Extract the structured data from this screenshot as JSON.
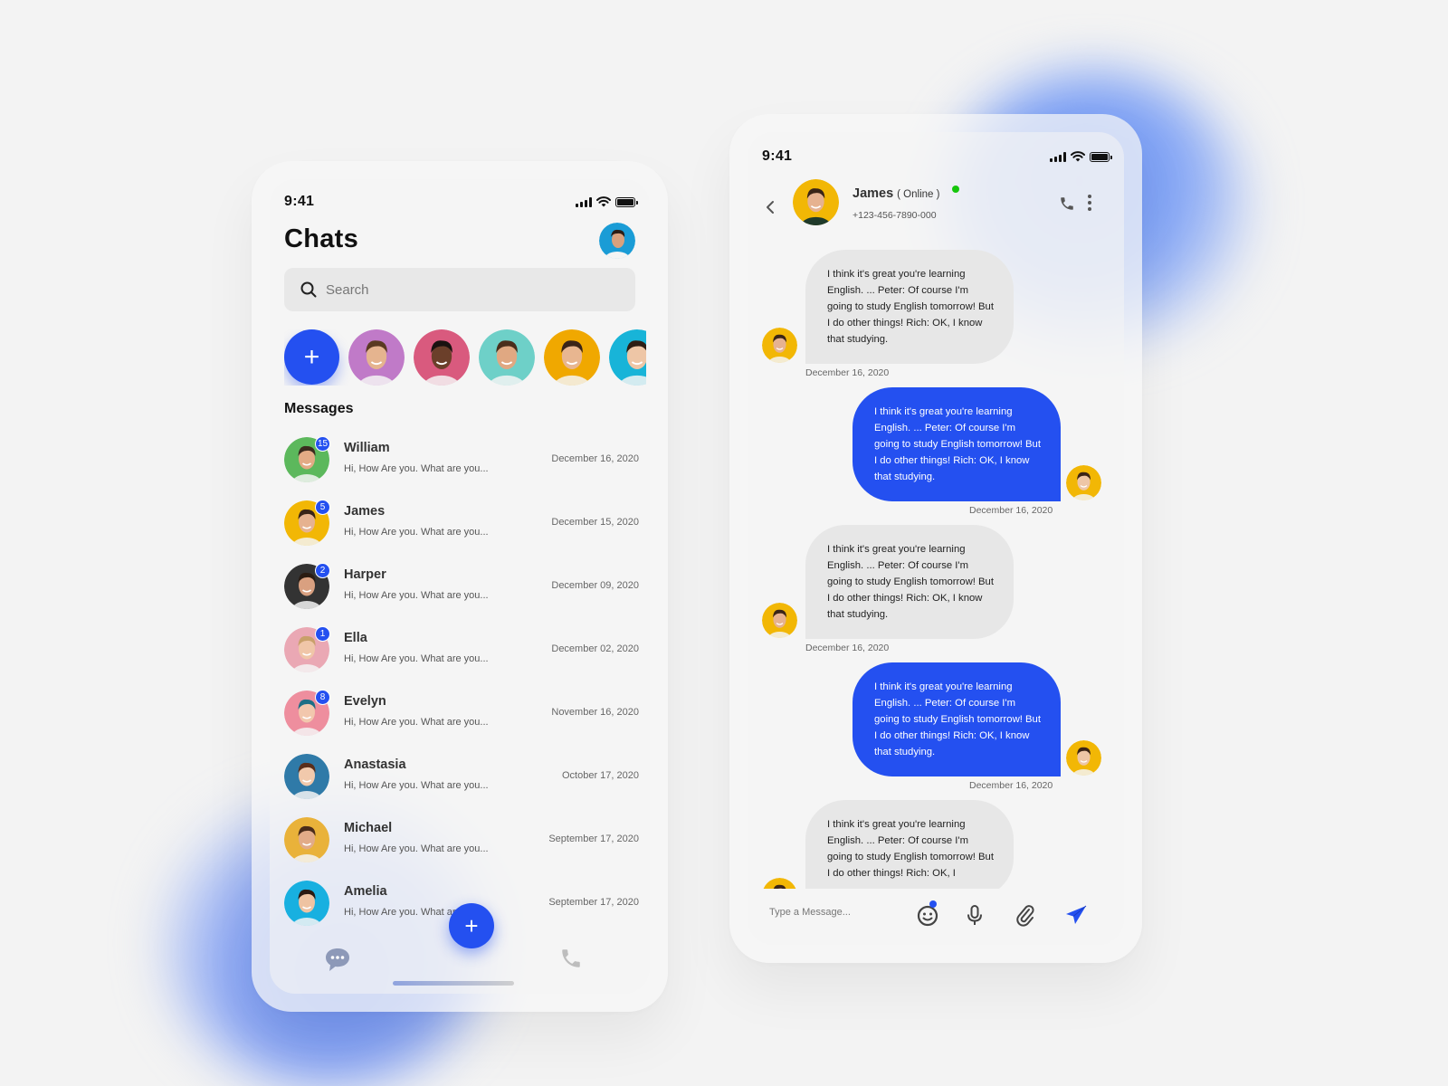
{
  "colors": {
    "accent": "#2450f0",
    "online": "#16c60c",
    "bubble_in": "#e7e7e7",
    "background": "#f3f3f3"
  },
  "chats_screen": {
    "status_time": "9:41",
    "title": "Chats",
    "search": {
      "placeholder": "Search",
      "value": ""
    },
    "add_story_label": "+",
    "stories": [
      {
        "name": "story-1",
        "bg": "#c07ac8",
        "skin": "#e5b48f",
        "hair": "#5a3a22"
      },
      {
        "name": "story-2",
        "bg": "#d95a7e",
        "skin": "#6b3f2a",
        "hair": "#1a1210"
      },
      {
        "name": "story-3",
        "bg": "#6ed0c8",
        "skin": "#e0a882",
        "hair": "#4a2e1c"
      },
      {
        "name": "story-4",
        "bg": "#f0a800",
        "skin": "#e8b690",
        "hair": "#3a2418"
      },
      {
        "name": "story-5",
        "bg": "#18b4d8",
        "skin": "#eec6a6",
        "hair": "#2e1e14"
      }
    ],
    "messages_heading": "Messages",
    "chats": [
      {
        "name": "William",
        "preview": "Hi, How Are you. What are you...",
        "date": "December 16, 2020",
        "unread": "15",
        "bg": "#5cb85c",
        "skin": "#e3ab85",
        "hair": "#3b2a1e"
      },
      {
        "name": "James",
        "preview": "Hi, How Are you. What are you...",
        "date": "December 15, 2020",
        "unread": "5",
        "bg": "#f2b705",
        "skin": "#e6b290",
        "hair": "#3a2517"
      },
      {
        "name": "Harper",
        "preview": "Hi, How Are you. What are you...",
        "date": "December 09, 2020",
        "unread": "2",
        "bg": "#333333",
        "skin": "#d9a080",
        "hair": "#2a1c12"
      },
      {
        "name": "Ella",
        "preview": "Hi, How Are you. What are you...",
        "date": "December 02, 2020",
        "unread": "1",
        "bg": "#eaa8b4",
        "skin": "#f0c6a8",
        "hair": "#c9a06a"
      },
      {
        "name": "Evelyn",
        "preview": "Hi, How Are you. What are you...",
        "date": "November 16, 2020",
        "unread": "8",
        "bg": "#ee8e9e",
        "skin": "#f2c7ad",
        "hair": "#1e6f86"
      },
      {
        "name": "Anastasia",
        "preview": "Hi, How Are you. What are you...",
        "date": "October 17, 2020",
        "unread": "",
        "bg": "#2f7aa8",
        "skin": "#f1c9ac",
        "hair": "#5a2e1a"
      },
      {
        "name": "Michael",
        "preview": "Hi, How Are you. What are you...",
        "date": "September 17, 2020",
        "unread": "",
        "bg": "#e9b23a",
        "skin": "#e2ab88",
        "hair": "#4a2c1a"
      },
      {
        "name": "Amelia",
        "preview": "Hi, How Are you. What are you...",
        "date": "September 17, 2020",
        "unread": "",
        "bg": "#18b0e0",
        "skin": "#eec3a2",
        "hair": "#2a1a12"
      }
    ],
    "fab_label": "+",
    "nav": {
      "chat_icon": "chat-bubble-icon",
      "call_icon": "phone-icon"
    }
  },
  "conversation_screen": {
    "status_time": "9:41",
    "contact": {
      "name": "James",
      "status": "( Online )",
      "phone": "+123-456-7890-000"
    },
    "messages": [
      {
        "direction": "in",
        "text": "I think it's great you're learning English. ... Peter: Of course I'm going to study English tomorrow! But I do other things! Rich: OK, I know that studying.",
        "date": "December 16, 2020"
      },
      {
        "direction": "out",
        "text": "I think it's great you're learning English. ... Peter: Of course I'm going to study English tomorrow! But I do other things! Rich: OK, I know that studying.",
        "date": "December 16, 2020"
      },
      {
        "direction": "in",
        "text": "I think it's great you're learning English. ... Peter: Of course I'm going to study English tomorrow! But I do other things! Rich: OK, I know that studying.",
        "date": "December 16, 2020"
      },
      {
        "direction": "out",
        "text": "I think it's great you're learning English. ... Peter: Of course I'm going to study English tomorrow! But I do other things! Rich: OK, I know that studying.",
        "date": "December 16, 2020"
      },
      {
        "direction": "in",
        "text": "I think it's great you're learning English. ... Peter: Of course I'm going to study English tomorrow! But I do other things! Rich: OK, I",
        "date": ""
      }
    ],
    "composer": {
      "placeholder": "Type a Message...",
      "value": ""
    }
  }
}
